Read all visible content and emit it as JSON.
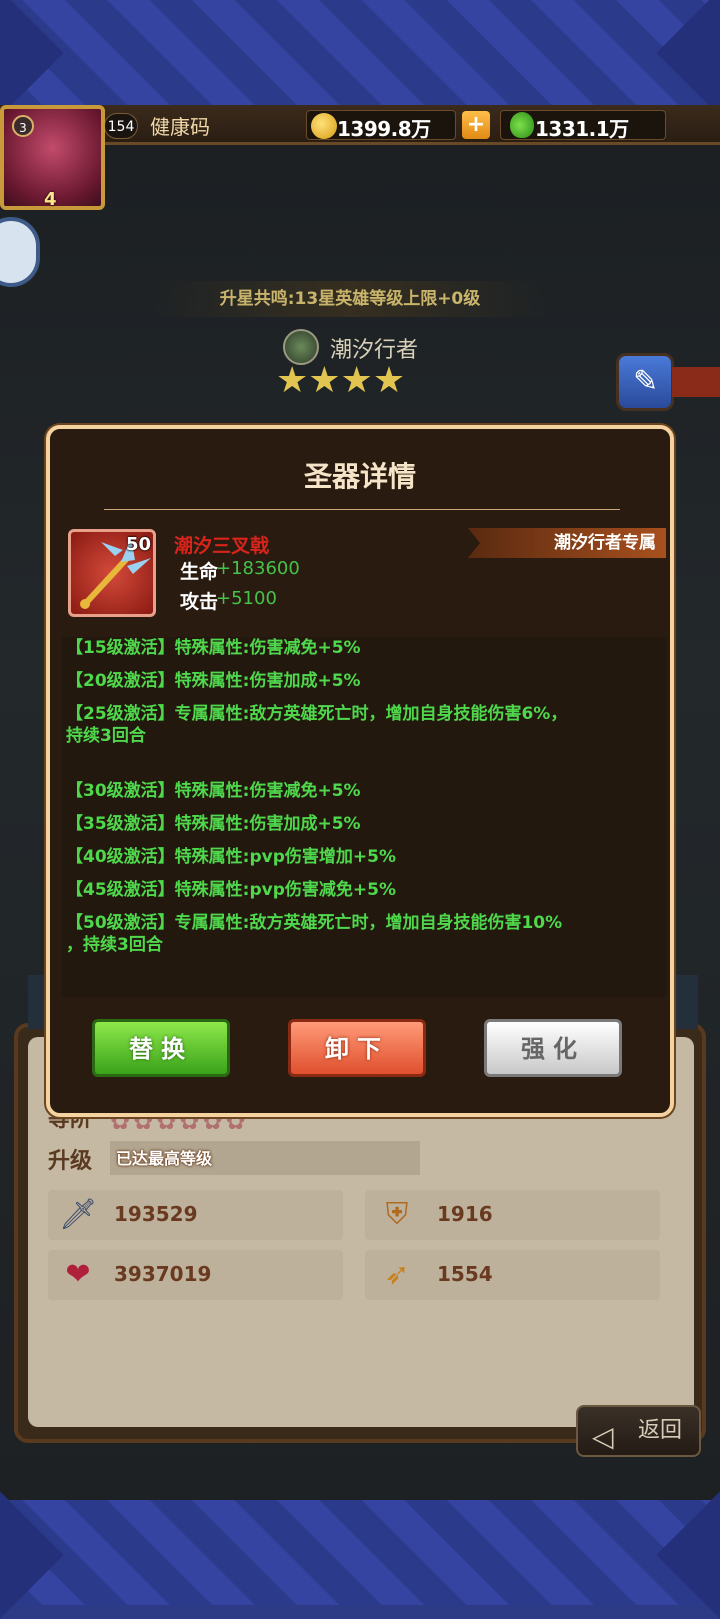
{
  "header": {
    "avatar_level": "3",
    "avatar_stars": "4",
    "vip": "154",
    "player_name": "健康码",
    "gold": "1399.8万",
    "plus_label": "+",
    "diamonds": "1331.1万"
  },
  "hero": {
    "resonance": "升星共鸣:13星英雄等级上限+0级",
    "name": "潮汐行者",
    "stars": "★★★★"
  },
  "modal": {
    "title": "圣器详情",
    "item_level": "50",
    "item_name": "潮汐三叉戟",
    "exclusive_tag": "潮汐行者专属",
    "attrs": [
      {
        "label": "生命",
        "value": "+183600"
      },
      {
        "label": "攻击",
        "value": "+5100"
      }
    ],
    "effects": [
      "【15级激活】特殊属性:伤害减免+5%",
      "【20级激活】特殊属性:伤害加成+5%",
      "【25级激活】专属属性:敌方英雄死亡时，增加自身技能伤害6%，",
      "持续3回合",
      "【30级激活】特殊属性:伤害减免+5%",
      "【35级激活】特殊属性:伤害加成+5%",
      "【40级激活】特殊属性:pvp伤害增加+5%",
      "【45级激活】特殊属性:pvp伤害减免+5%",
      "【50级激活】专属属性:敌方英雄死亡时，增加自身技能伤害10%",
      "，持续3回合"
    ],
    "buttons": {
      "replace": "替换",
      "unequip": "卸下",
      "enhance": "强化"
    }
  },
  "lower": {
    "rank_label": "等阶",
    "rank_stars": "✿✿✿✿✿✿",
    "upgrade_label": "升级",
    "upgrade_status": "已达最高等级",
    "stats": {
      "attack": "193529",
      "defense": "1916",
      "hp": "3937019",
      "speed": "1554"
    }
  },
  "back_label": "返回"
}
